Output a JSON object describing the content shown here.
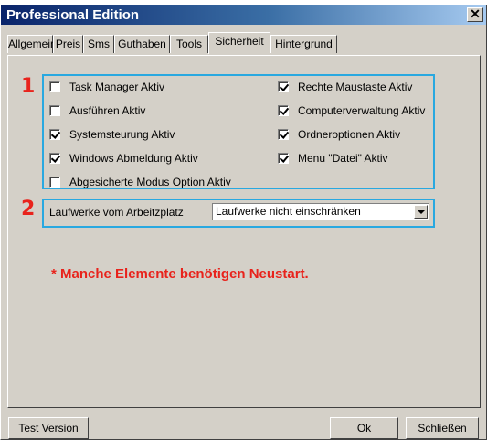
{
  "window": {
    "title": "Professional Edition",
    "close_glyph": "✕"
  },
  "tabs": [
    {
      "label": "Allgemein"
    },
    {
      "label": "Preis"
    },
    {
      "label": "Sms"
    },
    {
      "label": "Guthaben"
    },
    {
      "label": "Tools"
    },
    {
      "label": "Sicherheit",
      "active": true
    },
    {
      "label": "Hintergrund"
    }
  ],
  "annotations": {
    "box1_number": "1",
    "box2_number": "2",
    "highlight_color": "#29a8e0",
    "number_color": "#e8231c"
  },
  "security": {
    "checkboxes": [
      {
        "label": "Task Manager Aktiv",
        "checked": false
      },
      {
        "label": "Ausführen Aktiv",
        "checked": false
      },
      {
        "label": "Systemsteurung Aktiv",
        "checked": true
      },
      {
        "label": "Windows Abmeldung Aktiv",
        "checked": true
      },
      {
        "label": "Abgesicherte Modus Option Aktiv",
        "checked": false
      },
      {
        "label": "Rechte Maustaste Aktiv",
        "checked": true
      },
      {
        "label": "Computerverwaltung Aktiv",
        "checked": true
      },
      {
        "label": "Ordneroptionen Aktiv",
        "checked": true
      },
      {
        "label": "Menu \"Datei\" Aktiv",
        "checked": true
      }
    ],
    "drives_label": "Laufwerke vom Arbeitzplatz",
    "drives_value": "Laufwerke nicht einschränken",
    "notice": "* Manche Elemente benötigen Neustart."
  },
  "buttons": {
    "test_version": "Test Version",
    "ok": "Ok",
    "close": "Schließen"
  }
}
